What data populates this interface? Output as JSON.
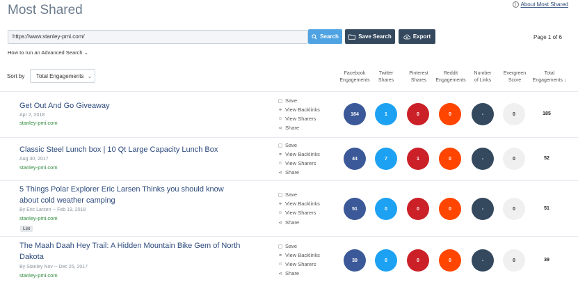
{
  "header": {
    "title": "Most Shared",
    "about_label": "About Most Shared"
  },
  "search": {
    "value": "https://www.stanley-pmi.com/",
    "search_label": "Search",
    "save_label": "Save Search",
    "export_label": "Export",
    "page_label": "Page 1 of 6"
  },
  "advanced": {
    "label": "How to run an Advanced Search"
  },
  "sort": {
    "label": "Sort by",
    "selected": "Total Engagements"
  },
  "columns": {
    "facebook": [
      "Facebook",
      "Engagements"
    ],
    "twitter": [
      "Twitter",
      "Shares"
    ],
    "pinterest": [
      "Pinterest",
      "Shares"
    ],
    "reddit": [
      "Reddit",
      "Engagements"
    ],
    "links": [
      "Number",
      "of Links"
    ],
    "evergreen": [
      "Evergreen",
      "Score"
    ],
    "total": [
      "Total",
      "Engagements"
    ]
  },
  "actions": {
    "save": "Save",
    "backlinks": "View Backlinks",
    "sharers": "View Sharers",
    "share": "Share"
  },
  "colors": {
    "facebook": "#3b5998",
    "twitter": "#1da1f2",
    "pinterest": "#cb2027",
    "reddit": "#ff4500",
    "links": "#34495e",
    "evergreen": "#f0f0f0"
  },
  "results": [
    {
      "title_lines": [
        "Get Out And Go Giveaway"
      ],
      "meta": "Apr 2, 2018",
      "domain": "stanley-pmi.com",
      "tag": "",
      "facebook": "184",
      "twitter": "1",
      "pinterest": "0",
      "reddit": "0",
      "links": "-",
      "evergreen": "0",
      "total": "185"
    },
    {
      "title_lines": [
        "Classic Steel Lunch box | 10 Qt Large Capacity Lunch Box"
      ],
      "meta": "Aug 30, 2017",
      "domain": "stanley-pmi.com",
      "tag": "",
      "facebook": "44",
      "twitter": "7",
      "pinterest": "1",
      "reddit": "0",
      "links": "-",
      "evergreen": "0",
      "total": "52"
    },
    {
      "title_lines": [
        "5 Things Polar Explorer Eric Larsen Thinks you should know",
        "about cold weather camping"
      ],
      "meta": "By Eric Larsen -- Feb 19, 2018",
      "domain": "stanley-pmi.com",
      "tag": "List",
      "facebook": "51",
      "twitter": "0",
      "pinterest": "0",
      "reddit": "0",
      "links": "-",
      "evergreen": "0",
      "total": "51"
    },
    {
      "title_lines": [
        "The Maah Daah Hey Trail: A Hidden Mountain Bike Gem of North",
        "Dakota"
      ],
      "meta": "By Stanley Nov -- Dec 25, 2017",
      "domain": "stanley-pmi.com",
      "tag": "",
      "facebook": "39",
      "twitter": "0",
      "pinterest": "0",
      "reddit": "0",
      "links": "-",
      "evergreen": "0",
      "total": "39"
    }
  ]
}
